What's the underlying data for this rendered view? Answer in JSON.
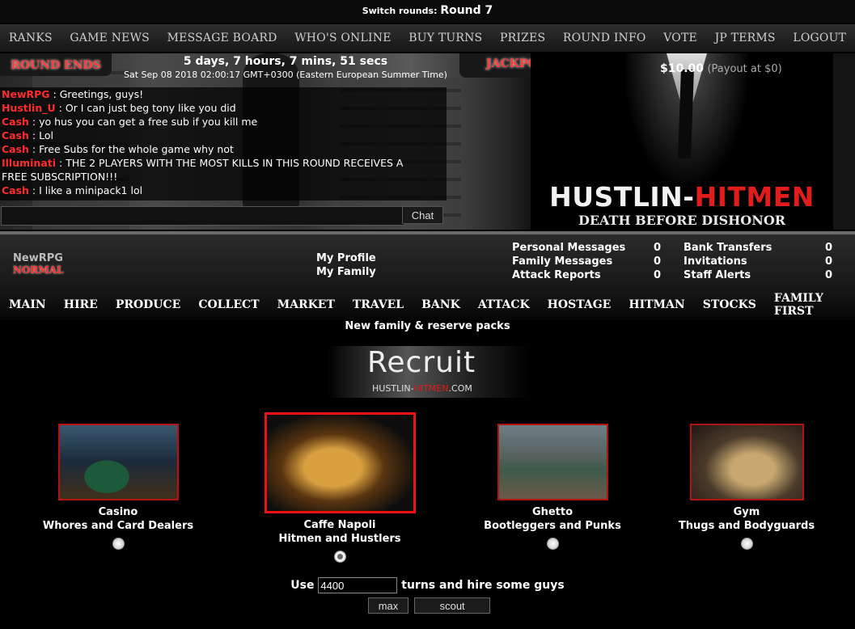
{
  "switch_rounds": {
    "label": "Switch rounds:",
    "value": "Round 7"
  },
  "top_nav": [
    "RANKS",
    "GAME NEWS",
    "MESSAGE BOARD",
    "WHO'S ONLINE",
    "BUY TURNS",
    "PRIZES",
    "ROUND INFO",
    "VOTE",
    "JP TERMS",
    "LOGOUT"
  ],
  "round": {
    "ends_label": "ROUND ENDS",
    "countdown": "5 days, 7 hours, 7 mins, 51 secs",
    "end_time": "Sat Sep 08 2018 02:00:17 GMT+0300 (Eastern European Summer Time)"
  },
  "jackpot": {
    "label": "JACKPOT",
    "amount": "$10.00",
    "payout": "(Payout at $0)"
  },
  "chat": {
    "messages": [
      {
        "user": "NewRPG",
        "text": " : Greetings, guys!"
      },
      {
        "user": "Hustlin_U",
        "text": " : Or I can just beg tony like you did"
      },
      {
        "user": "Cash",
        "text": " : yo hus you can get a free sub if you kill me"
      },
      {
        "user": "Cash",
        "text": " : Lol"
      },
      {
        "user": "Cash",
        "text": " : Free Subs for the whole game why not"
      },
      {
        "user": "Illuminati",
        "text": " : THE 2 PLAYERS WITH THE MOST KILLS IN THIS ROUND RECEIVES A FREE SUBSCRIPTION!!!"
      },
      {
        "user": "Cash",
        "text": " : I like a minipack1 lol"
      }
    ],
    "input_value": "",
    "button": "Chat"
  },
  "poster": {
    "title_white": "HUSTLIN-",
    "title_red": "HITMEN",
    "tagline": "DEATH BEFORE DISHONOR"
  },
  "user": {
    "name": "NewRPG",
    "rank": "NORMAL"
  },
  "profile_links": [
    "My Profile",
    "My Family"
  ],
  "counts_left": [
    {
      "label": "Personal Messages",
      "value": "0"
    },
    {
      "label": "Family Messages",
      "value": "0"
    },
    {
      "label": "Attack Reports",
      "value": "0"
    }
  ],
  "counts_right": [
    {
      "label": "Bank Transfers",
      "value": "0"
    },
    {
      "label": "Invitations",
      "value": "0"
    },
    {
      "label": "Staff Alerts",
      "value": "0"
    }
  ],
  "main_nav": [
    "MAIN",
    "HIRE",
    "PRODUCE",
    "COLLECT",
    "MARKET",
    "TRAVEL",
    "BANK",
    "ATTACK",
    "HOSTAGE",
    "HITMAN",
    "STOCKS",
    "FAMILY FIRST"
  ],
  "notice": "New family & reserve packs",
  "recruit": {
    "title": "Recruit",
    "site_white_1": "HUSTLIN-",
    "site_red": "HITMEN",
    "site_white_2": ".COM"
  },
  "locations": [
    {
      "name": "Casino",
      "desc": "Whores and Card Dealers",
      "selected": false
    },
    {
      "name": "Caffe Napoli",
      "desc": "Hitmen and Hustlers",
      "selected": true
    },
    {
      "name": "Ghetto",
      "desc": "Bootleggers and Punks",
      "selected": false
    },
    {
      "name": "Gym",
      "desc": "Thugs and Bodyguards",
      "selected": false
    }
  ],
  "hire": {
    "prefix": "Use",
    "turns": "4400",
    "suffix": "turns and hire some guys",
    "max_button": "max",
    "scout_button": "scout"
  }
}
